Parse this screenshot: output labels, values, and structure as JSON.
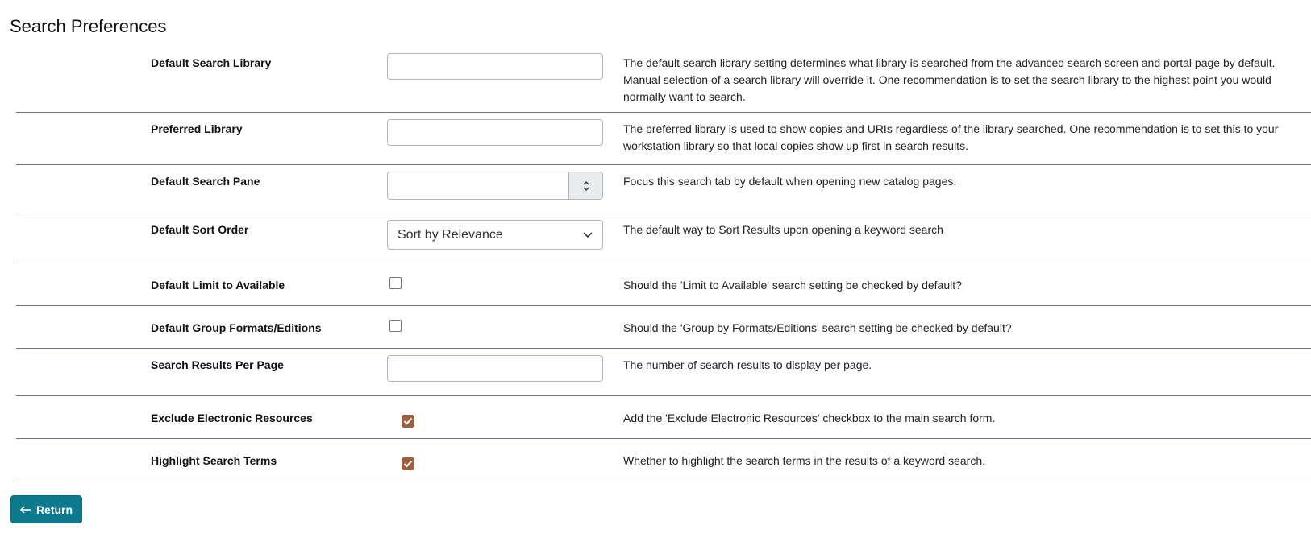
{
  "page": {
    "title": "Search Preferences"
  },
  "rows": {
    "default_search_library": {
      "label": "Default Search Library",
      "value": "",
      "description": "The default search library setting determines what library is searched from the advanced search screen and portal page by default. Manual selection of a search library will override it. One recommendation is to set the search library to the highest point you would normally want to search."
    },
    "preferred_library": {
      "label": "Preferred Library",
      "value": "",
      "description": "The preferred library is used to show copies and URIs regardless of the library searched. One recommendation is to set this to your workstation library so that local copies show up first in search results."
    },
    "default_search_pane": {
      "label": "Default Search Pane",
      "value": "",
      "description": "Focus this search tab by default when opening new catalog pages."
    },
    "default_sort_order": {
      "label": "Default Sort Order",
      "selected": "Sort by Relevance",
      "description": "The default way to Sort Results upon opening a keyword search"
    },
    "default_limit_to_available": {
      "label": "Default Limit to Available",
      "checked": false,
      "description": "Should the 'Limit to Available' search setting be checked by default?"
    },
    "default_group_formats_editions": {
      "label": "Default Group Formats/Editions",
      "checked": false,
      "description": "Should the 'Group by Formats/Editions' search setting be checked by default?"
    },
    "search_results_per_page": {
      "label": "Search Results Per Page",
      "value": "",
      "description": "The number of search results to display per page."
    },
    "exclude_electronic_resources": {
      "label": "Exclude Electronic Resources",
      "checked": true,
      "description": "Add the 'Exclude Electronic Resources' checkbox to the main search form."
    },
    "highlight_search_terms": {
      "label": "Highlight Search Terms",
      "checked": true,
      "description": "Whether to highlight the search terms in the results of a keyword search."
    }
  },
  "return_button": {
    "label": "Return",
    "icon": "arrow-left-icon"
  },
  "colors": {
    "checkbox_checked": "#9c5f3f",
    "return_button": "#0c7a8c",
    "row_divider": "#6c757d"
  }
}
